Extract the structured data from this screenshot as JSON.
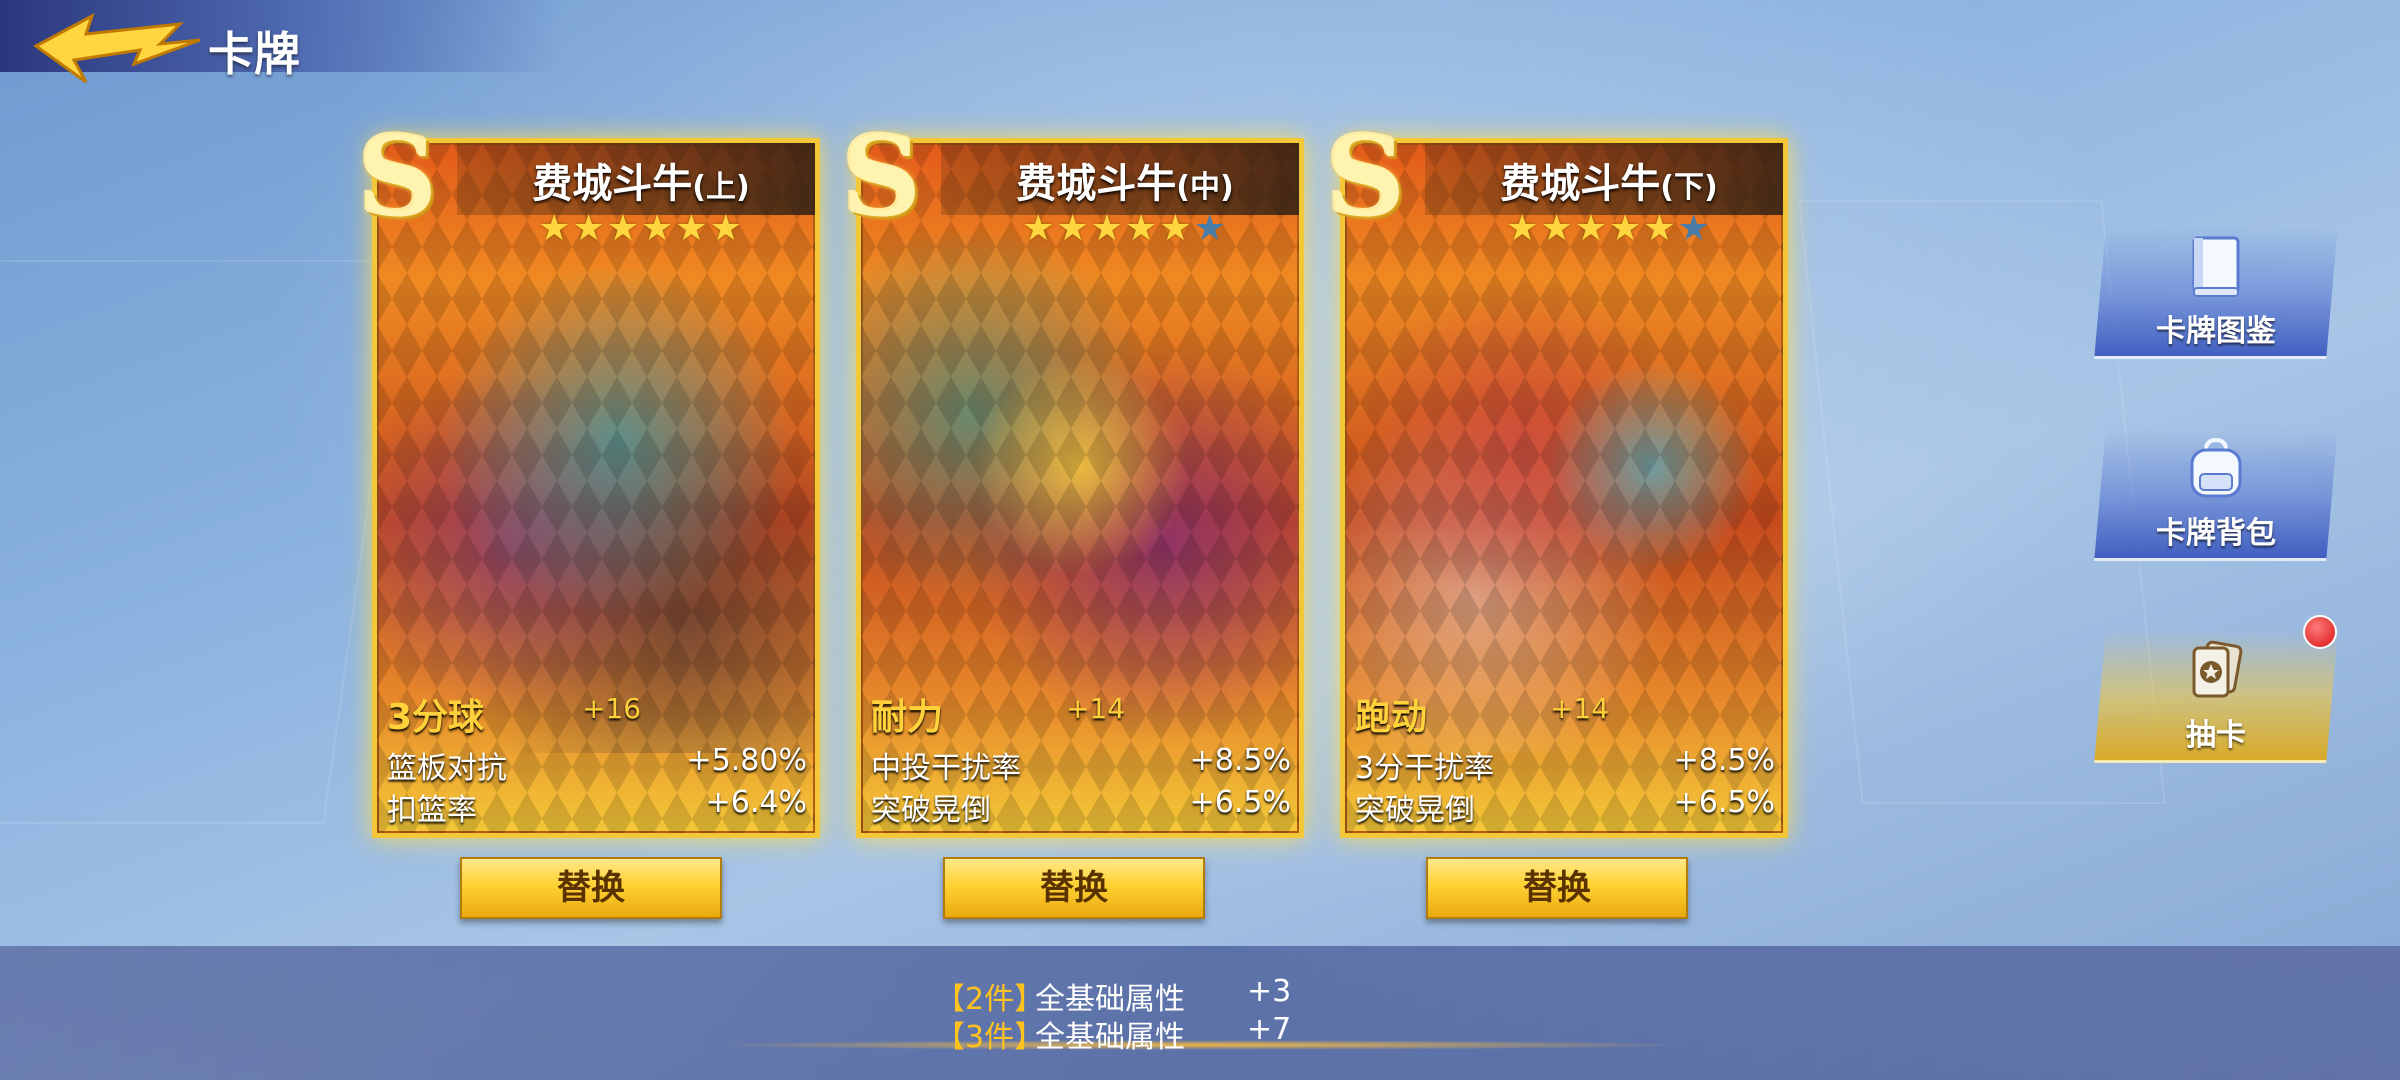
{
  "header": {
    "title": "卡牌"
  },
  "cards": [
    {
      "grade": "S",
      "name": "费城斗牛",
      "part": "(上)",
      "stars_filled": 6,
      "stars_total": 6,
      "main_attr": "3分球",
      "main_bonus": "+16",
      "stats": [
        {
          "label": "篮板对抗",
          "value": "+5.80%"
        },
        {
          "label": "扣篮率",
          "value": "+6.4%"
        }
      ]
    },
    {
      "grade": "S",
      "name": "费城斗牛",
      "part": "(中)",
      "stars_filled": 5,
      "stars_total": 6,
      "main_attr": "耐力",
      "main_bonus": "+14",
      "stats": [
        {
          "label": "中投干扰率",
          "value": "+8.5%"
        },
        {
          "label": "突破晃倒",
          "value": "+6.5%"
        }
      ]
    },
    {
      "grade": "S",
      "name": "费城斗牛",
      "part": "(下)",
      "stars_filled": 5,
      "stars_total": 6,
      "main_attr": "跑动",
      "main_bonus": "+14",
      "stats": [
        {
          "label": "3分干扰率",
          "value": "+8.5%"
        },
        {
          "label": "突破晃倒",
          "value": "+6.5%"
        }
      ]
    }
  ],
  "replace_label": "替换",
  "side_menu": [
    {
      "label": "卡牌图鉴",
      "icon": "book-icon"
    },
    {
      "label": "卡牌背包",
      "icon": "backpack-icon"
    },
    {
      "label": "抽卡",
      "icon": "card-draw-icon",
      "notification": true
    }
  ],
  "set_bonus": [
    {
      "open": "【",
      "count": "2件",
      "close": "】",
      "name": "全基础属性",
      "value": "+3"
    },
    {
      "open": "【",
      "count": "3件",
      "close": "】",
      "name": "全基础属性",
      "value": "+7"
    }
  ],
  "colors": {
    "accent_gold": "#ffd233",
    "card_border": "#f3c838",
    "side_blue": "#3c5abe",
    "notification_red": "#d81414"
  }
}
